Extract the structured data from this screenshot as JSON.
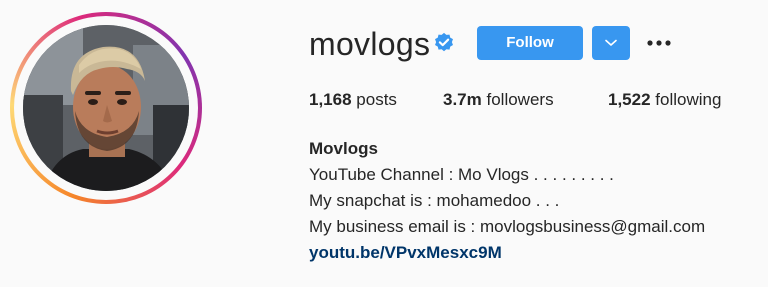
{
  "profile": {
    "username": "movlogs",
    "verified": true,
    "follow_label": "Follow",
    "stats": {
      "posts_count": "1,168",
      "posts_label": "posts",
      "followers_count": "3.7m",
      "followers_label": "followers",
      "following_count": "1,522",
      "following_label": "following"
    },
    "bio": {
      "name": "Movlogs",
      "lines": [
        "YouTube Channel : Mo Vlogs . . . . . . . . .",
        "My snapchat is : mohamedoo . . .",
        "My business email is : movlogsbusiness@gmail.com"
      ],
      "link": "youtu.be/VPvxMesxc9M"
    }
  },
  "icons": {
    "verified": "verified-badge-icon",
    "dropdown": "chevron-down-icon",
    "more": "more-options-icon"
  },
  "colors": {
    "primary_button": "#3897f0",
    "link": "#003569",
    "text": "#262626",
    "background": "#fafafa"
  }
}
